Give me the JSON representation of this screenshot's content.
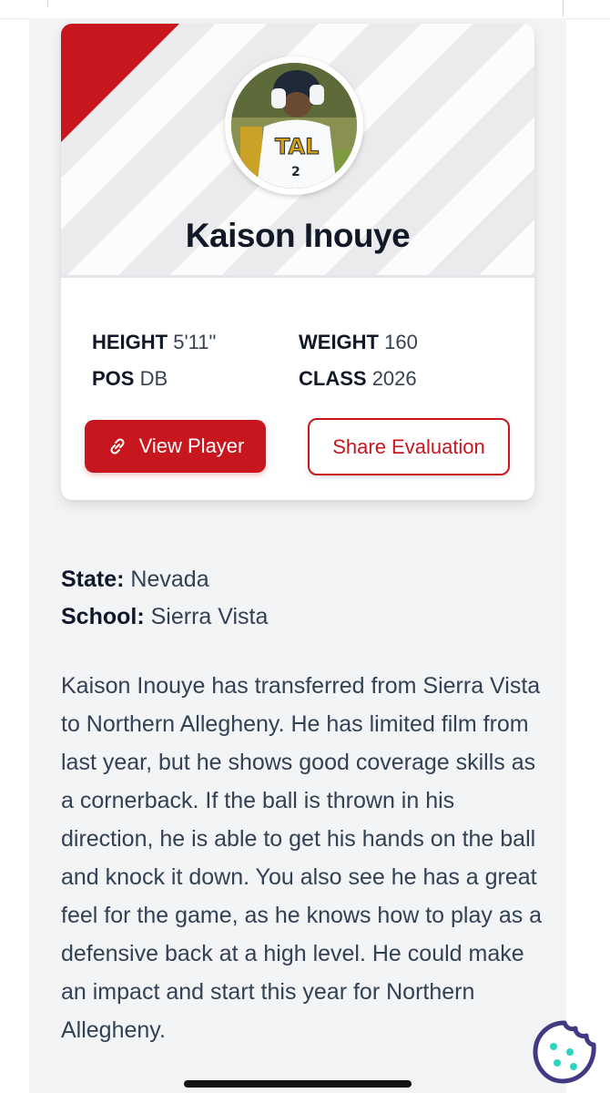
{
  "player": {
    "name": "Kaison Inouye",
    "photo_alt": "player-photo"
  },
  "stats": {
    "height_label": "HEIGHT",
    "height_value": "5'11\"",
    "weight_label": "WEIGHT",
    "weight_value": "160",
    "pos_label": "POS",
    "pos_value": "DB",
    "class_label": "CLASS",
    "class_value": "2026"
  },
  "buttons": {
    "view_player": "View Player",
    "share_evaluation": "Share Evaluation"
  },
  "info": {
    "state_label": "State:",
    "state_value": "Nevada",
    "school_label": "School:",
    "school_value": "Sierra Vista"
  },
  "bio": {
    "text": "Kaison Inouye has transferred from Sierra Vista to Northern Allegheny. He has limited film from last year, but he shows good coverage skills as a cornerback. If the ball is thrown in his direction, he is able to get his hands on the ball and knock it down. You also see he has a great feel for the game, as he knows how to play as a defensive back at a high level. He could make an impact and start this year for Northern Allegheny."
  },
  "colors": {
    "accent": "#c8161e",
    "cookie_icon": "#3f3a82",
    "cookie_dots": "#2dd4bf"
  },
  "icons": {
    "link": "link-icon",
    "cookie": "cookie-icon"
  }
}
